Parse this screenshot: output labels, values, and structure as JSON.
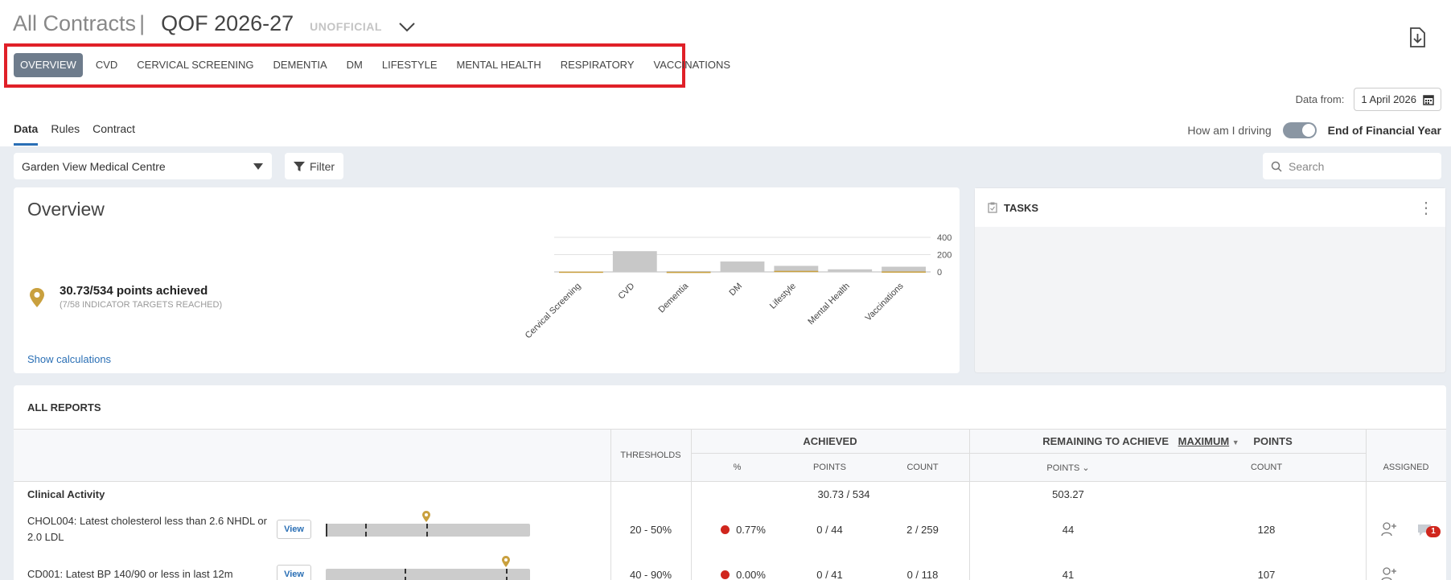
{
  "header": {
    "app_title": "All Contracts",
    "separator": "|",
    "contract": "QOF 2026-27",
    "status": "UNOFFICIAL"
  },
  "tabs": [
    {
      "label": "OVERVIEW",
      "active": true
    },
    {
      "label": "CVD"
    },
    {
      "label": "CERVICAL SCREENING"
    },
    {
      "label": "DEMENTIA"
    },
    {
      "label": "DM"
    },
    {
      "label": "LIFESTYLE"
    },
    {
      "label": "MENTAL HEALTH"
    },
    {
      "label": "RESPIRATORY"
    },
    {
      "label": "VACCINATIONS"
    }
  ],
  "data_from": {
    "label": "Data from:",
    "value": "1 April 2026"
  },
  "subtabs": [
    {
      "label": "Data",
      "active": true
    },
    {
      "label": "Rules"
    },
    {
      "label": "Contract"
    }
  ],
  "driving": {
    "label": "How am I driving",
    "value": "End of Financial Year"
  },
  "toolbar": {
    "practice": "Garden View Medical Centre",
    "filter_label": "Filter",
    "search_placeholder": "Search"
  },
  "overview": {
    "title": "Overview",
    "points": "30.73/534 points achieved",
    "targets": "(7/58 INDICATOR TARGETS REACHED)",
    "show_calcs": "Show calculations"
  },
  "chart_data": {
    "type": "bar",
    "categories": [
      "Cervical Screening",
      "CVD",
      "Dementia",
      "DM",
      "Lifestyle",
      "Mental Health",
      "Vaccinations"
    ],
    "series": [
      {
        "values": [
          5,
          240,
          10,
          120,
          70,
          30,
          60
        ]
      },
      {
        "values": [
          3,
          0,
          1,
          0,
          12,
          0,
          5
        ]
      }
    ],
    "yticks": [
      400,
      200,
      0
    ],
    "ylim": [
      0,
      400
    ]
  },
  "tasks": {
    "title": "TASKS"
  },
  "reports": {
    "title": "ALL REPORTS",
    "headers": {
      "thresholds": "THRESHOLDS",
      "achieved": "ACHIEVED",
      "remaining": "REMAINING TO ACHIEVE",
      "maximum": "MAXIMUM",
      "points": "POINTS",
      "pct": "%",
      "achieved_points": "POINTS",
      "count": "COUNT",
      "rem_points": "POINTS",
      "rem_count": "COUNT",
      "assigned": "ASSIGNED"
    },
    "section": {
      "label": "Clinical Activity",
      "achieved": "30.73 / 534",
      "remaining": "503.27"
    },
    "rows": [
      {
        "name": "CHOL004: Latest cholesterol less than 2.6 NHDL or 2.0 LDL",
        "view": "View",
        "thresholds": "20 - 50%",
        "pct": "0.77%",
        "points": "0 / 44",
        "count": "2 / 259",
        "rem_points": "44",
        "rem_count": "128",
        "comments": "1"
      },
      {
        "name": "CD001: Latest BP 140/90 or less in last 12m",
        "view": "View",
        "thresholds": "40 - 90%",
        "pct": "0.00%",
        "points": "0 / 41",
        "count": "0 / 118",
        "rem_points": "41",
        "rem_count": "107"
      }
    ]
  }
}
